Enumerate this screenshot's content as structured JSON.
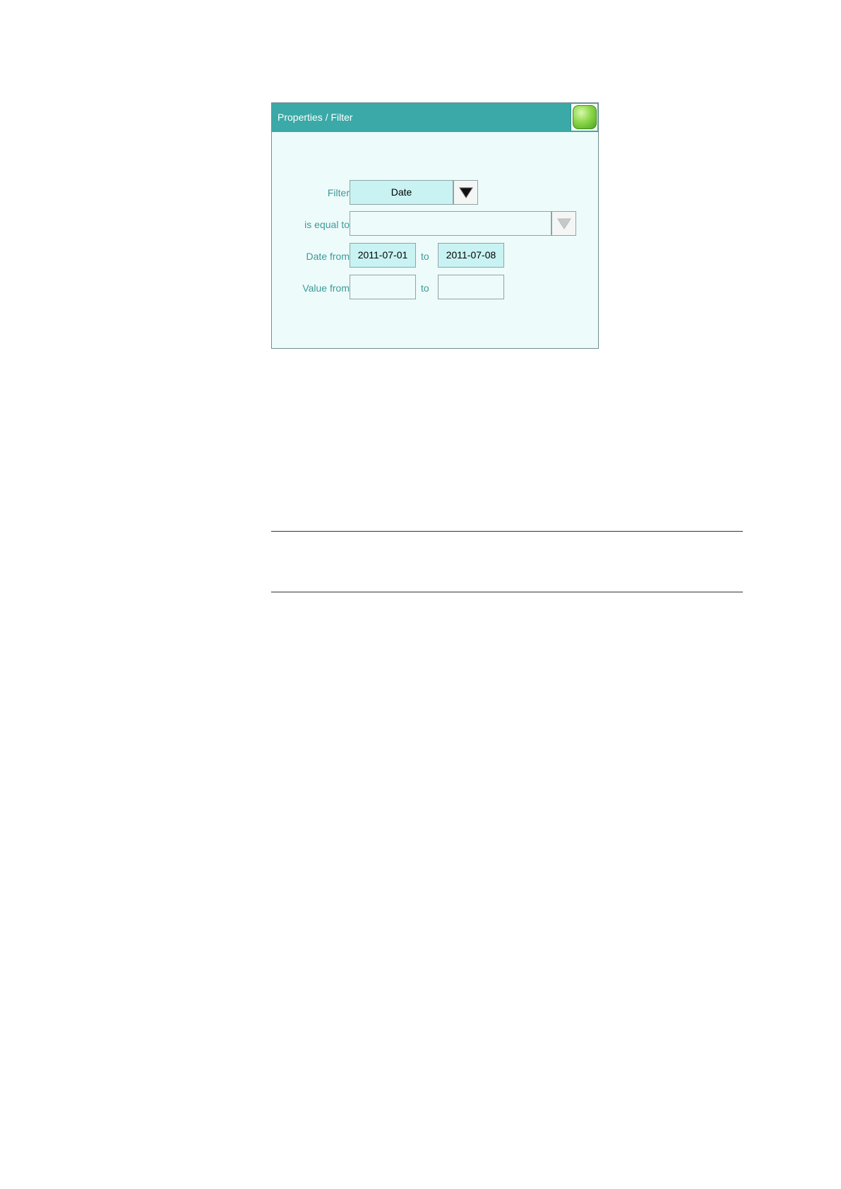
{
  "dialog": {
    "title": "Properties / Filter"
  },
  "form": {
    "filter_label": "Filter",
    "filter_value": "Date",
    "equal_label": "is equal to",
    "equal_value": "",
    "date_from_label": "Date from",
    "date_from_value": "2011-07-01",
    "date_to_label": "to",
    "date_to_value": "2011-07-08",
    "value_from_label": "Value from",
    "value_from_value": "",
    "value_to_label": "to",
    "value_to_value": ""
  },
  "icons": {
    "home": "green-home-icon",
    "filter_dropdown": "triangle-down-icon",
    "equal_dropdown": "triangle-down-icon-disabled"
  },
  "colors": {
    "titlebar": "#3aa9a7",
    "label": "#3a9a98",
    "background": "#eefbfb",
    "field_filled": "#c9f3f3"
  }
}
